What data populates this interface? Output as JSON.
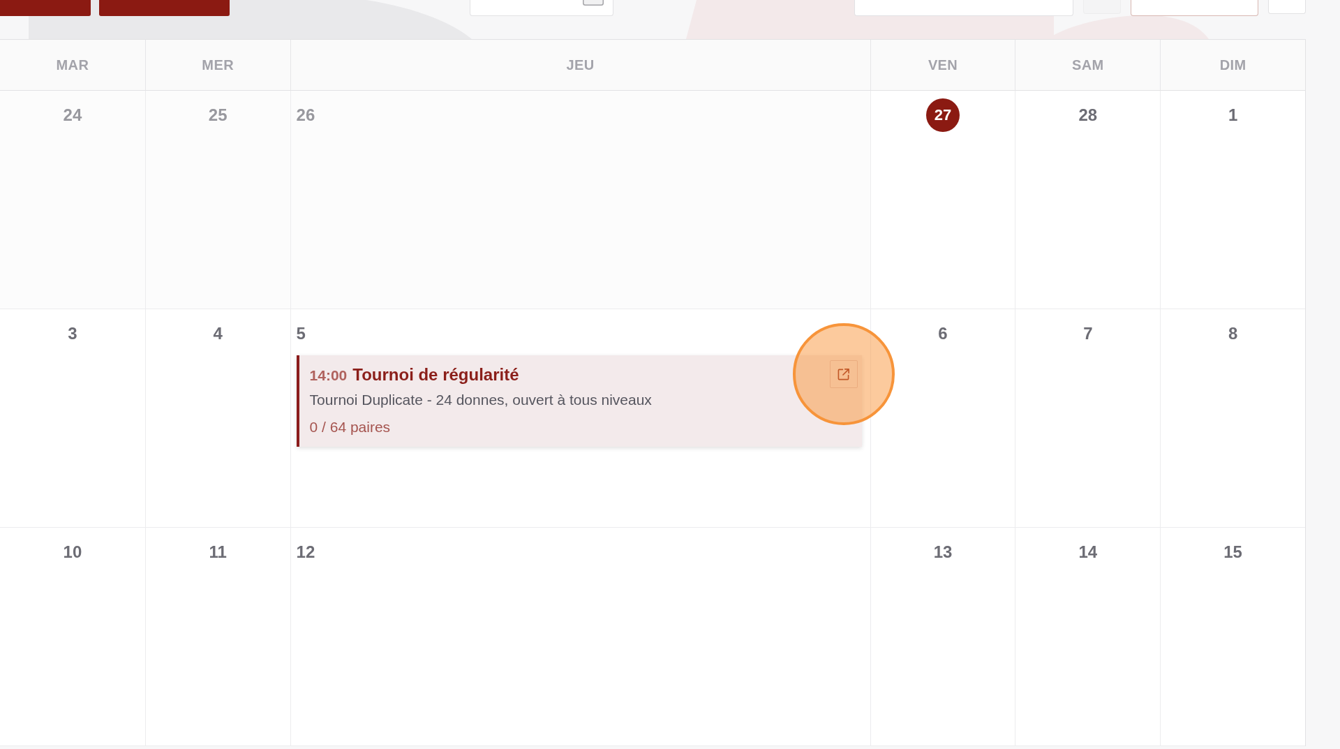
{
  "toolbar": {
    "items": [
      {
        "kind": "primary"
      },
      {
        "kind": "primary"
      },
      {
        "kind": "create"
      },
      {
        "kind": "date-range"
      },
      {
        "kind": "prev"
      },
      {
        "kind": "today"
      },
      {
        "kind": "next"
      }
    ]
  },
  "calendar": {
    "weekdays": [
      {
        "label": "MAR",
        "expanded": false
      },
      {
        "label": "MER",
        "expanded": false
      },
      {
        "label": "JEU",
        "expanded": true
      },
      {
        "label": "VEN",
        "expanded": false
      },
      {
        "label": "SAM",
        "expanded": false
      },
      {
        "label": "DIM",
        "expanded": false
      }
    ],
    "weeks": [
      {
        "days": [
          {
            "number": "24",
            "past": true,
            "today": false
          },
          {
            "number": "25",
            "past": true,
            "today": false
          },
          {
            "number": "26",
            "past": true,
            "today": false
          },
          {
            "number": "27",
            "past": false,
            "today": true
          },
          {
            "number": "28",
            "past": false,
            "today": false
          },
          {
            "number": "1",
            "past": false,
            "today": false
          }
        ]
      },
      {
        "days": [
          {
            "number": "3",
            "past": false,
            "today": false
          },
          {
            "number": "4",
            "past": false,
            "today": false
          },
          {
            "number": "5",
            "past": false,
            "today": false,
            "events": [
              {
                "time": "14:00",
                "title": "Tournoi de régularité",
                "description": "Tournoi Duplicate - 24 donnes, ouvert à tous niveaux",
                "capacity": "0 / 64 paires",
                "highlighted": true
              }
            ]
          },
          {
            "number": "6",
            "past": false,
            "today": false
          },
          {
            "number": "7",
            "past": false,
            "today": false
          },
          {
            "number": "8",
            "past": false,
            "today": false
          }
        ]
      },
      {
        "days": [
          {
            "number": "10",
            "past": false,
            "today": false
          },
          {
            "number": "11",
            "past": false,
            "today": false
          },
          {
            "number": "12",
            "past": false,
            "today": false
          },
          {
            "number": "13",
            "past": false,
            "today": false
          },
          {
            "number": "14",
            "past": false,
            "today": false
          },
          {
            "number": "15",
            "past": false,
            "today": false
          }
        ]
      }
    ]
  }
}
